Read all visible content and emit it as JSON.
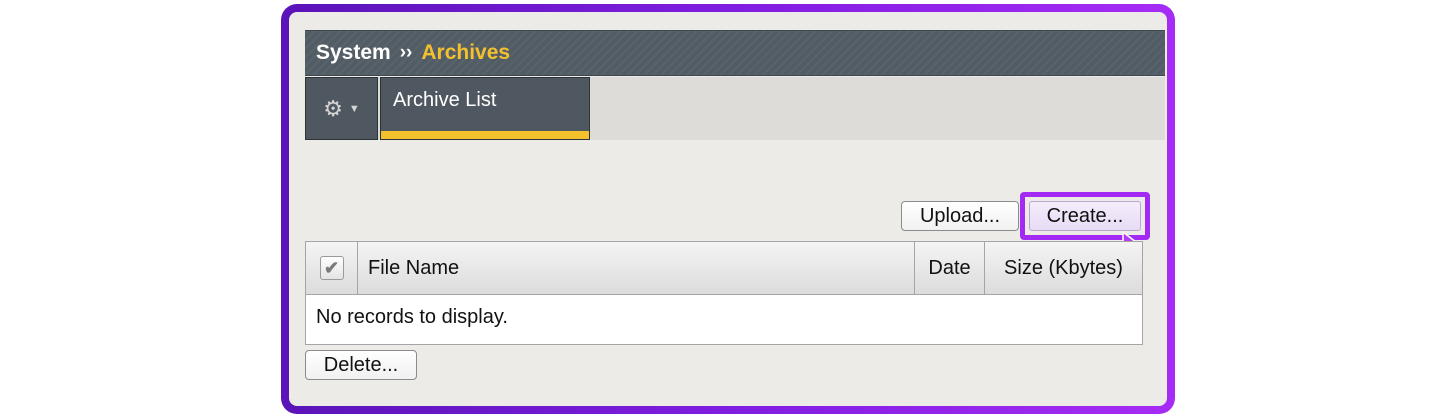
{
  "breadcrumb": {
    "system": "System",
    "separator": "››",
    "current": "Archives"
  },
  "tabs": {
    "gear_icon": "gear-icon",
    "archive_list": "Archive List"
  },
  "actions": {
    "upload": "Upload...",
    "create": "Create...",
    "delete": "Delete..."
  },
  "table": {
    "columns": [
      "File Name",
      "Date",
      "Size (Kbytes)"
    ],
    "empty_message": "No records to display."
  },
  "colors": {
    "accent": "#f3c12d",
    "header_bg": "#525c65",
    "highlight": "#a32af2"
  }
}
